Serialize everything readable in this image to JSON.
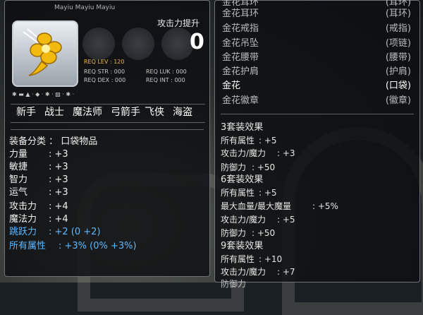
{
  "item_tooltip": {
    "title_partial": "Mayiu Mayiu Mayiu",
    "attack_boost_label": "攻击力提升",
    "attack_boost_value": "0",
    "req_lev": "REQ LEV : 120",
    "req_str": "REQ STR : 000",
    "req_luk": "REQ LUK : 000",
    "req_dex": "REQ DEX : 000",
    "req_int": "REQ INT : 000",
    "jobs": [
      "新手",
      "战士",
      "魔法师",
      "弓箭手",
      "飞侠",
      "海盗"
    ],
    "category_label": "装备分类 ： 口袋物品",
    "stats": [
      {
        "label": "力量",
        "value": ": +3",
        "color": "#f0f0f0"
      },
      {
        "label": "敏捷",
        "value": ": +3",
        "color": "#f0f0f0"
      },
      {
        "label": "智力",
        "value": ": +3",
        "color": "#f0f0f0"
      },
      {
        "label": "运气",
        "value": ": +3",
        "color": "#f0f0f0"
      },
      {
        "label": "攻击力",
        "value": ": +4",
        "color": "#f0f0f0"
      },
      {
        "label": "魔法力",
        "value": ": +4",
        "color": "#f0f0f0"
      },
      {
        "label": "跳跃力",
        "value": ": +2 (0 +2)",
        "color": "#5fb8ff"
      },
      {
        "label": "所有属性",
        "value": ": +3% (0% +3%)",
        "color": "#5fb8ff"
      }
    ]
  },
  "set_tooltip": {
    "items": [
      {
        "name": "金花耳环",
        "slot": "(耳环)"
      },
      {
        "name": "金花戒指",
        "slot": "(戒指)"
      },
      {
        "name": "金花吊坠",
        "slot": "(项链)"
      },
      {
        "name": "金花腰带",
        "slot": "(腰带)"
      },
      {
        "name": "金花护肩",
        "slot": "(护肩)"
      },
      {
        "name": "金花",
        "slot": "(口袋)"
      },
      {
        "name": "金花徽章",
        "slot": "(徽章)"
      }
    ],
    "set3_title": "3套装效果",
    "set3": [
      {
        "label": "所有属性",
        "value": ": +5"
      },
      {
        "label": "攻击力/魔力",
        "value": ": +3"
      },
      {
        "label": "防御力",
        "value": ": +50"
      }
    ],
    "set6_title": "6套装效果",
    "set6": [
      {
        "label": "所有属性",
        "value": ": +5"
      },
      {
        "label": "最大血量/最大魔量",
        "value": ": +5%"
      },
      {
        "label": "攻击力/魔力",
        "value": ": +5"
      },
      {
        "label": "防御力",
        "value": ": +50"
      }
    ],
    "set9_title": "9套装效果",
    "set9": [
      {
        "label": "所有属性",
        "value": ": +10"
      },
      {
        "label": "攻击力/魔力",
        "value": ": +7"
      },
      {
        "label": "防御力",
        "value": ""
      }
    ]
  }
}
